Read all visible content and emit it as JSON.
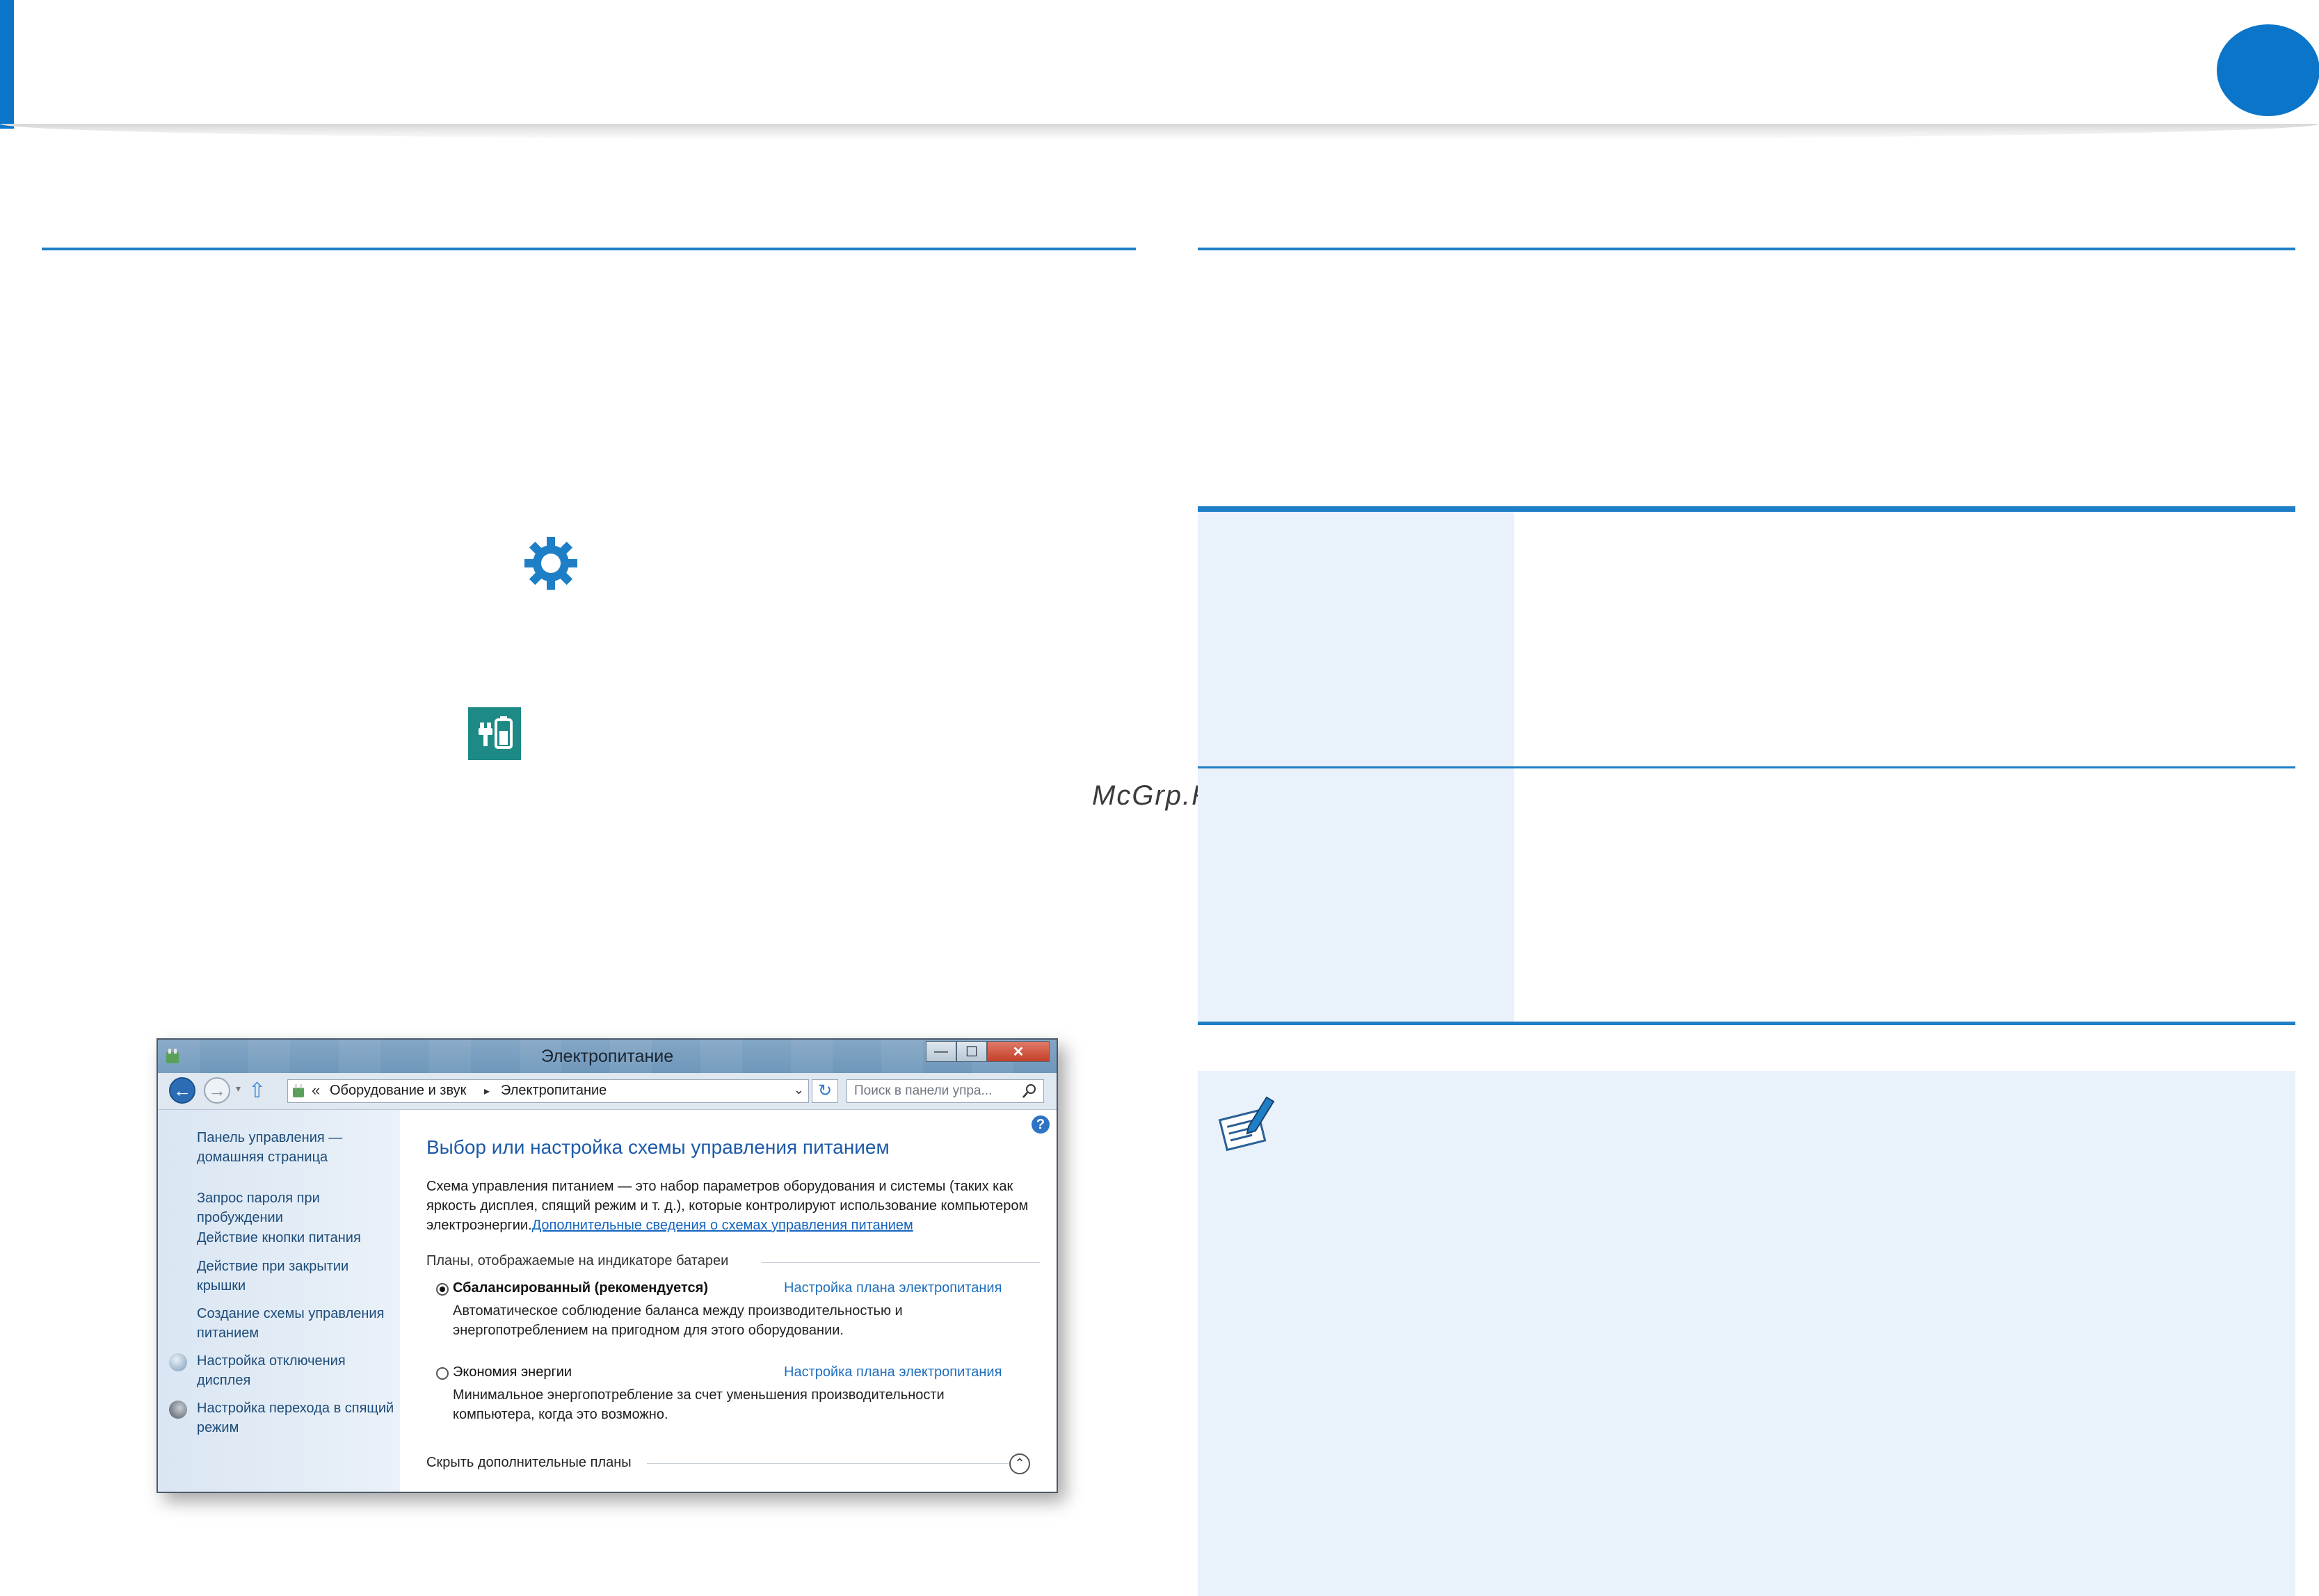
{
  "watermark": "McGrp.Ru",
  "window": {
    "title": "Электропитание",
    "controls": {
      "minimize": "—",
      "maximize": "☐",
      "close": "✕"
    },
    "address": {
      "chevron": "«",
      "crumbs": [
        "Оборудование и звук",
        "Электропитание"
      ],
      "separator": "▸",
      "dropdown": "⌄",
      "refresh": "↻",
      "search_placeholder": "Поиск в панели упра..."
    },
    "sidebar": {
      "items": [
        {
          "label": "Панель управления — домашняя страница"
        },
        {
          "label": "Запрос пароля при пробуждении"
        },
        {
          "label": "Действие кнопки питания"
        },
        {
          "label": "Действие при закрытии крышки"
        },
        {
          "label": "Создание схемы управления питанием"
        },
        {
          "label": "Настройка отключения дисплея"
        },
        {
          "label": "Настройка перехода в спящий режим"
        }
      ]
    },
    "main": {
      "help": "?",
      "heading": "Выбор или настройка схемы управления питанием",
      "description": "Схема управления питанием — это набор параметров оборудования и системы (таких как яркость дисплея, спящий режим и т. д.), которые контролируют использование компьютером электроэнергии.",
      "description_link": "Дополнительные сведения о схемах управления питанием",
      "plans_header": "Планы, отображаемые на индикаторе батареи",
      "plans": [
        {
          "label": "Сбалансированный (рекомендуется)",
          "selected": true,
          "link": "Настройка плана электропитания",
          "description": "Автоматическое соблюдение баланса между производительностью и энергопотреблением на пригодном для этого оборудовании."
        },
        {
          "label": "Экономия энергии",
          "selected": false,
          "link": "Настройка плана электропитания",
          "description": "Минимальное энергопотребление за счет уменьшения производительности компьютера, когда это возможно."
        }
      ],
      "hide_plans": "Скрыть дополнительные планы",
      "collapse": "⌃"
    }
  },
  "colors": {
    "accent": "#0a75c9",
    "rule": "#1e7fc6",
    "table_shade": "#e9f1fb",
    "tile": "#1d8a86"
  }
}
